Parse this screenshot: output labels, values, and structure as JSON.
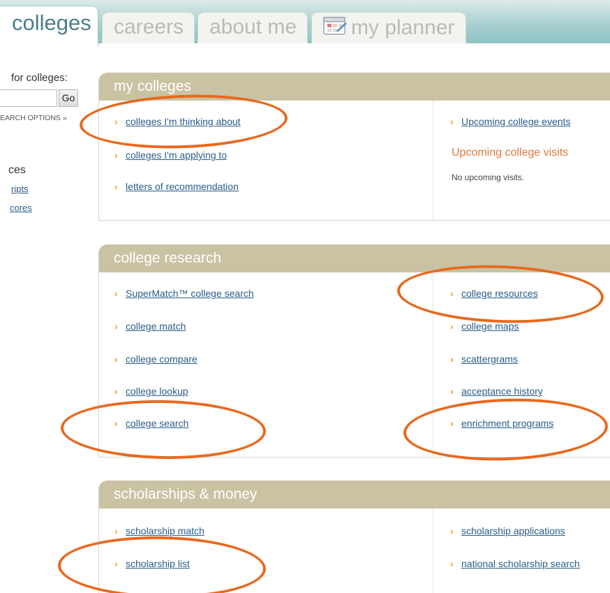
{
  "tabs": {
    "colleges": "colleges",
    "careers": "careers",
    "about_me": "about me",
    "my_planner": "my planner"
  },
  "sidebar": {
    "search_label": "for colleges:",
    "search_button": "Go",
    "search_options": "EARCH OPTIONS »",
    "resources_heading": "ces",
    "links": [
      "ripts",
      "cores"
    ]
  },
  "my_colleges": {
    "title": "my colleges",
    "left_links": [
      "colleges I'm thinking about",
      "colleges I'm applying to",
      "letters of recommendation"
    ],
    "upcoming_events": "Upcoming college events",
    "visits_title": "Upcoming college visits",
    "visits_text": "No upcoming visits."
  },
  "college_research": {
    "title": "college research",
    "left_links": [
      "SuperMatch™ college search",
      "college match",
      "college compare",
      "college lookup",
      "college search"
    ],
    "right_links": [
      "college resources",
      "college maps",
      "scattergrams",
      "acceptance history",
      "enrichment programs"
    ]
  },
  "scholarships": {
    "title": "scholarships & money",
    "left_links": [
      "scholarship match",
      "scholarship list"
    ],
    "right_links": [
      "scholarship applications",
      "national scholarship search"
    ]
  },
  "colors": {
    "accent_orange": "#e8691e",
    "panel_header": "#c9c3a3",
    "link": "#2a5c8a",
    "arrow": "#f0a316",
    "tab_bar": "#8fc3c4"
  }
}
